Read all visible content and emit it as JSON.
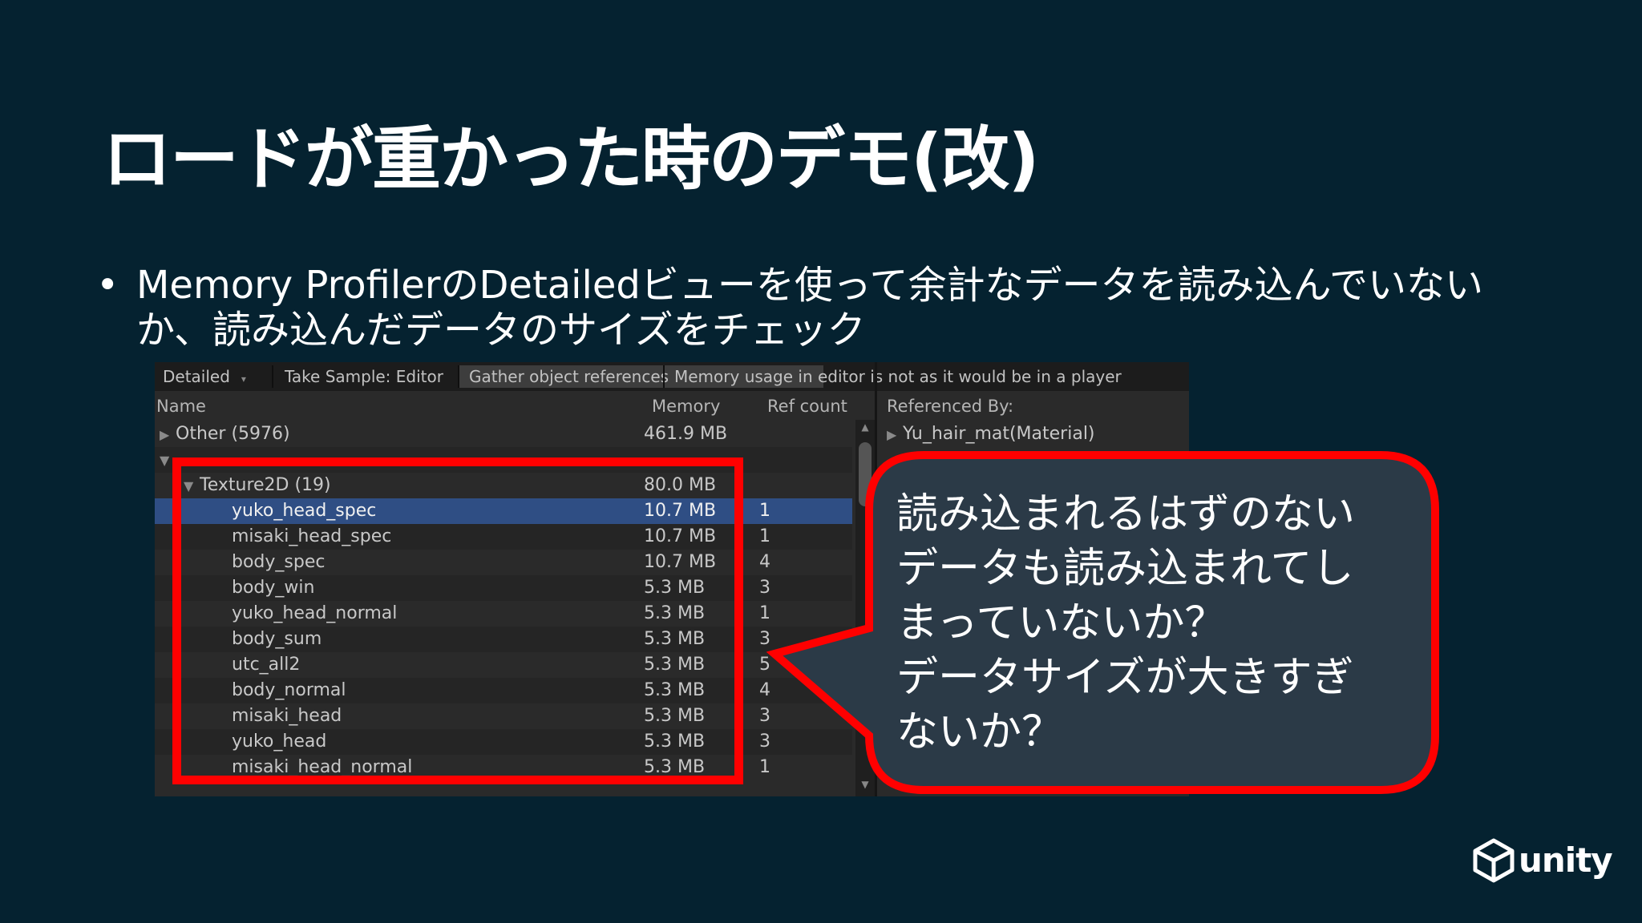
{
  "slide": {
    "title": "ロードが重かった時のデモ(改)",
    "bullet_text": "Memory ProfilerのDetailedビューを使って余計なデータを読み込んでいないか、読み込んだデータのサイズをチェック"
  },
  "profiler": {
    "toolbar": {
      "view_mode": "Detailed",
      "take_sample": "Take Sample: Editor",
      "gather_refs": "Gather object references",
      "notice": "Memory usage in editor is not as it would be in a player"
    },
    "columns": {
      "name": "Name",
      "memory": "Memory",
      "ref_count": "Ref count",
      "referenced_by": "Referenced By:"
    },
    "rows": [
      {
        "name": "Other (5976)",
        "memory": "461.9 MB",
        "refs": ""
      },
      {
        "name": "Texture2D (19)",
        "memory": "80.0 MB",
        "refs": ""
      },
      {
        "name": "yuko_head_spec",
        "memory": "10.7 MB",
        "refs": "1"
      },
      {
        "name": "misaki_head_spec",
        "memory": "10.7 MB",
        "refs": "1"
      },
      {
        "name": "body_spec",
        "memory": "10.7 MB",
        "refs": "4"
      },
      {
        "name": "body_win",
        "memory": "5.3 MB",
        "refs": "3"
      },
      {
        "name": "yuko_head_normal",
        "memory": "5.3 MB",
        "refs": "1"
      },
      {
        "name": "body_sum",
        "memory": "5.3 MB",
        "refs": "3"
      },
      {
        "name": "utc_all2",
        "memory": "5.3 MB",
        "refs": "5"
      },
      {
        "name": "body_normal",
        "memory": "5.3 MB",
        "refs": "4"
      },
      {
        "name": "misaki_head",
        "memory": "5.3 MB",
        "refs": "3"
      },
      {
        "name": "yuko_head",
        "memory": "5.3 MB",
        "refs": "3"
      },
      {
        "name": "misaki_head_normal",
        "memory": "5.3 MB",
        "refs": "1"
      }
    ],
    "referenced_by_item": "Yu_hair_mat(Material)"
  },
  "callout": {
    "lines": [
      "読み込まれるはずのない",
      "データも読み込まれてし",
      "まっていないか？",
      "データサイズが大きすぎ",
      "ないか？"
    ]
  },
  "logo": {
    "text": "unity"
  },
  "colors": {
    "background": "#052230",
    "highlight": "#ff0000",
    "selection": "#2f4e84",
    "bubble_fill": "#2b3a47"
  }
}
